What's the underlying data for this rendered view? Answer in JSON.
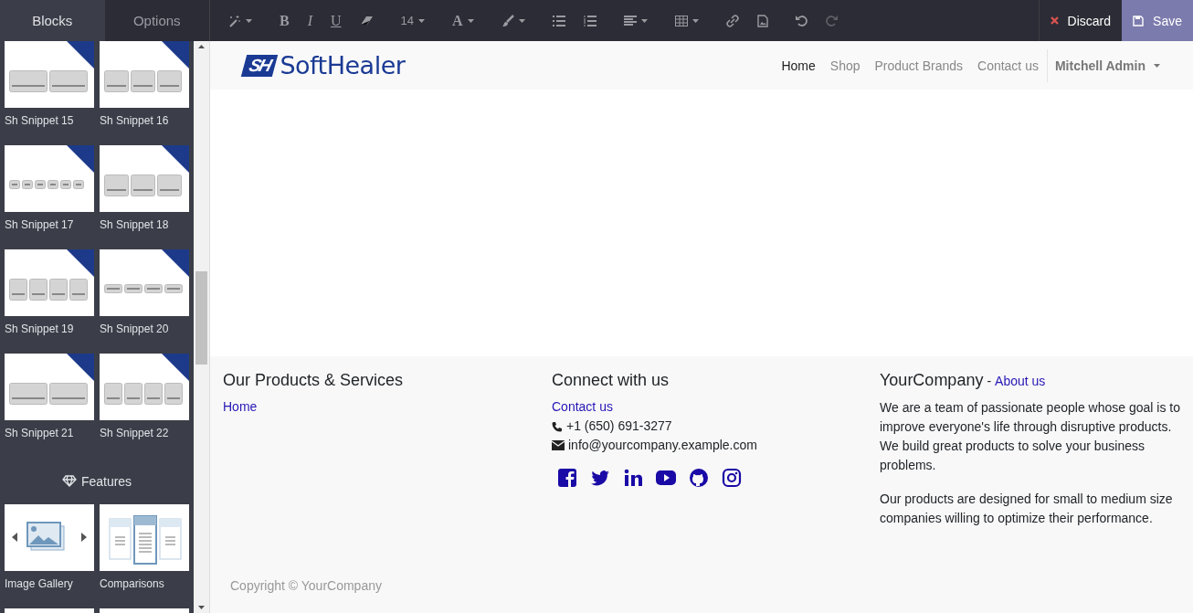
{
  "sidebar": {
    "tabs": [
      {
        "label": "Blocks",
        "selected": true
      },
      {
        "label": "Options",
        "selected": false
      }
    ],
    "sections": [
      {
        "blocks": [
          {
            "label": "Sh Snippet 15",
            "badge": true
          },
          {
            "label": "Sh Snippet 16",
            "badge": true
          },
          {
            "label": "Sh Snippet 17",
            "badge": true
          },
          {
            "label": "Sh Snippet 18",
            "badge": true
          },
          {
            "label": "Sh Snippet 19",
            "badge": true
          },
          {
            "label": "Sh Snippet 20",
            "badge": true
          },
          {
            "label": "Sh Snippet 21",
            "badge": true
          },
          {
            "label": "Sh Snippet 22",
            "badge": true
          }
        ]
      },
      {
        "heading": "Features",
        "blocks": [
          {
            "label": "Image Gallery",
            "badge": false
          },
          {
            "label": "Comparisons",
            "badge": false
          },
          {
            "badge": false
          },
          {
            "badge": false
          }
        ]
      }
    ]
  },
  "toolbar": [
    {
      "kind": "icon",
      "caret": true,
      "disabled": false
    },
    {
      "kind": "text",
      "label": "B",
      "caret": false,
      "disabled": false
    },
    {
      "kind": "text",
      "label": "I",
      "caret": false,
      "disabled": false
    },
    {
      "kind": "text",
      "label": "U",
      "caret": false,
      "disabled": false
    },
    {
      "kind": "icon",
      "caret": false,
      "disabled": false
    },
    {
      "kind": "text",
      "label": "14",
      "caret": true,
      "disabled": false
    },
    {
      "kind": "text",
      "label": "A",
      "caret": true,
      "disabled": false
    },
    {
      "kind": "icon",
      "caret": true,
      "disabled": false
    },
    {
      "kind": "icon",
      "caret": false,
      "disabled": false
    },
    {
      "kind": "icon",
      "caret": false,
      "disabled": false
    },
    {
      "kind": "icon",
      "caret": true,
      "disabled": false
    },
    {
      "kind": "icon",
      "caret": true,
      "disabled": false
    },
    {
      "kind": "icon",
      "caret": false,
      "disabled": false
    },
    {
      "kind": "icon",
      "caret": false,
      "disabled": false
    },
    {
      "kind": "icon",
      "caret": false,
      "disabled": false
    },
    {
      "kind": "icon",
      "caret": false,
      "disabled": true
    }
  ],
  "actions": [
    {
      "label": "Discard",
      "kind": "discard"
    },
    {
      "label": "Save",
      "kind": "save"
    }
  ],
  "site": {
    "logo": {
      "mark": "SH",
      "text": "SoftHealer"
    },
    "nav": [
      {
        "label": "Home",
        "selected": true
      },
      {
        "label": "Shop",
        "selected": false
      },
      {
        "label": "Product Brands",
        "selected": false
      },
      {
        "label": "Contact us",
        "selected": false
      }
    ],
    "user": "Mitchell Admin",
    "footer": {
      "columns": [
        {
          "title": "Our Products & Services",
          "links": [
            "Home"
          ],
          "social": false
        },
        {
          "title": "Connect with us",
          "links": [
            "Contact us"
          ],
          "contacts": [
            {
              "kind": "phone",
              "text": "+1 (650) 691-3277"
            },
            {
              "kind": "email",
              "text": "info@yourcompany.example.com"
            }
          ],
          "social": true
        },
        {
          "title": "YourCompany",
          "title_separator": "-",
          "title_link": "About us",
          "social": false,
          "paragraphs": [
            "We are a team of passionate people whose goal is to improve everyone's life through disruptive products. We build great products to solve your business problems.",
            "Our products are designed for small to medium size companies willing to optimize their performance."
          ]
        }
      ],
      "copyright": "Copyright © YourCompany"
    }
  }
}
